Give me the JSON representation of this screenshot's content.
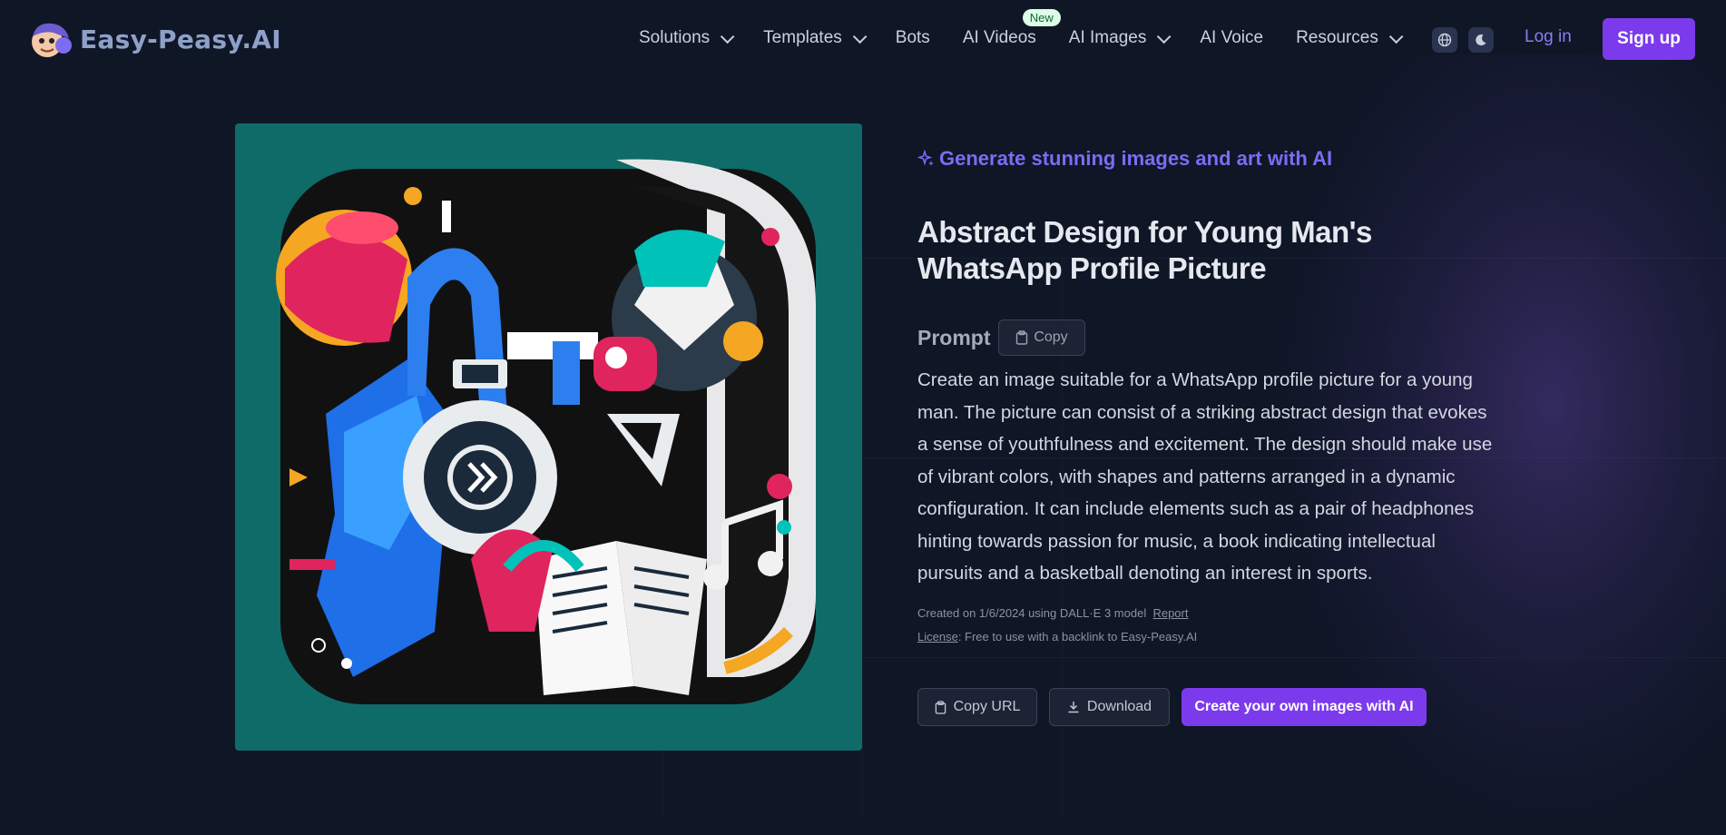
{
  "header": {
    "brand": "Easy-Peasy.AI",
    "nav": [
      {
        "label": "Solutions",
        "dropdown": true
      },
      {
        "label": "Templates",
        "dropdown": true
      },
      {
        "label": "Bots",
        "dropdown": false
      },
      {
        "label": "AI Videos",
        "dropdown": false,
        "badge": "New"
      },
      {
        "label": "AI Images",
        "dropdown": true
      },
      {
        "label": "AI Voice",
        "dropdown": false
      },
      {
        "label": "Resources",
        "dropdown": true
      }
    ],
    "language_icon": "globe-icon",
    "theme_icon": "moon-icon",
    "login": "Log in",
    "signup": "Sign up"
  },
  "main": {
    "tagline": "Generate stunning images and art with AI",
    "title": "Abstract Design for Young Man's WhatsApp Profile Picture",
    "prompt_label": "Prompt",
    "copy_label": "Copy",
    "prompt_text": "Create an image suitable for a WhatsApp profile picture for a young man. The picture can consist of a striking abstract design that evokes a sense of youthfulness and excitement. The design should make use of vibrant colors, with shapes and patterns arranged in a dynamic configuration. It can include elements such as a pair of headphones hinting towards passion for music, a book indicating intellectual pursuits and a basketball denoting an interest in sports.",
    "created": "Created on 1/6/2024 using DALL·E 3 model",
    "report": "Report",
    "license_label": "License",
    "license_text": ": Free to use with a backlink to Easy-Peasy.AI",
    "buttons": {
      "copy_url": "Copy URL",
      "download": "Download",
      "create": "Create your own images with AI"
    }
  },
  "colors": {
    "accent": "#7c3aed",
    "background": "#0f1626",
    "art_background": "#0f6b68"
  }
}
